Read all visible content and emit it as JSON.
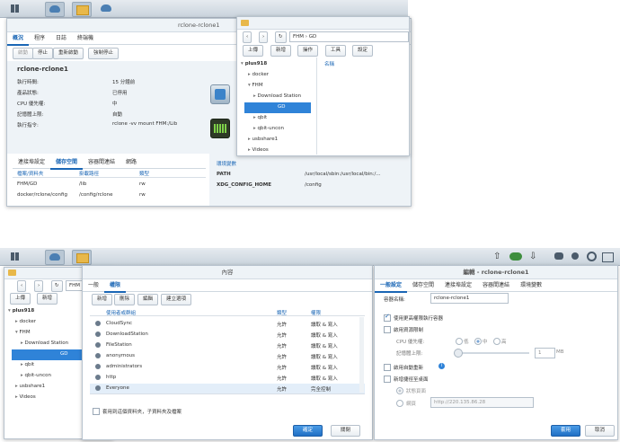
{
  "top_window": {
    "title": "rclone-rclone1",
    "tabs": [
      "概況",
      "程序",
      "日誌",
      "終端機"
    ],
    "buttons": [
      "啟動",
      "停止",
      "重新啟動",
      "強制停止"
    ],
    "container_name": "rclone-rclone1",
    "info": [
      {
        "k": "執行時間:",
        "v": "15 分鐘前"
      },
      {
        "k": "產品狀態:",
        "v": "已停用"
      },
      {
        "k": "CPU 優先權:",
        "v": "中"
      },
      {
        "k": "記憶體上限:",
        "v": "自動"
      },
      {
        "k": "執行指令:",
        "v": "rclone -vv mount FHM:/Lib"
      }
    ],
    "sub_tabs": [
      "連接埠設定",
      "儲存空間",
      "容器間連結",
      "網路"
    ],
    "vol_headers": [
      "檔案/資料夾",
      "掛載路徑",
      "類型"
    ],
    "volumes": [
      {
        "path": "FHM/GD",
        "mount": "/lib",
        "type": "rw"
      },
      {
        "path": "docker/rclone/config",
        "mount": "/config/rclone",
        "type": "rw"
      }
    ],
    "env_title": "環境變數",
    "env": [
      {
        "k": "PATH",
        "v": "/usr/local/sbin:/usr/local/bin:/..."
      },
      {
        "k": "XDG_CONFIG_HOME",
        "v": "/config"
      }
    ]
  },
  "fs_top": {
    "path": "FHM › GD",
    "toolbar": [
      "上傳",
      "新增",
      "操作",
      "工具",
      "設定"
    ],
    "col_name": "名稱",
    "tree": [
      {
        "label": "plus918",
        "bold": true,
        "lvl": 0
      },
      {
        "label": "docker",
        "lvl": 1
      },
      {
        "label": "FHM",
        "lvl": 1
      },
      {
        "label": "Download Station",
        "lvl": 2
      },
      {
        "label": "GD",
        "lvl": 2,
        "sel": true
      },
      {
        "label": "qbit",
        "lvl": 2
      },
      {
        "label": "qbit-uncon",
        "lvl": 2
      },
      {
        "label": "usbshare1",
        "lvl": 1
      },
      {
        "label": "Videos",
        "lvl": 1
      }
    ]
  },
  "fs_bottom": {
    "path": "FHM › GD",
    "toolbar": [
      "上傳",
      "新增"
    ],
    "tree": [
      {
        "label": "plus918",
        "bold": true,
        "lvl": 0
      },
      {
        "label": "docker",
        "lvl": 1
      },
      {
        "label": "FHM",
        "lvl": 1
      },
      {
        "label": "Download Station",
        "lvl": 2
      },
      {
        "label": "GD",
        "lvl": 2,
        "sel": true
      },
      {
        "label": "qbit",
        "lvl": 2
      },
      {
        "label": "qbit-uncon",
        "lvl": 2
      },
      {
        "label": "usbshare1",
        "lvl": 1
      },
      {
        "label": "Videos",
        "lvl": 1
      }
    ]
  },
  "props": {
    "title": "內容",
    "tabs": [
      "一般",
      "權限"
    ],
    "buttons": [
      "新增",
      "刪除",
      "編輯",
      "建立選項"
    ],
    "headers": [
      "使用者或群組",
      "類型",
      "權限"
    ],
    "rows": [
      {
        "name": "CloudSync",
        "type": "允許",
        "perm": "讀取 & 寫入"
      },
      {
        "name": "DownloadStation",
        "type": "允許",
        "perm": "讀取 & 寫入"
      },
      {
        "name": "FileStation",
        "type": "允許",
        "perm": "讀取 & 寫入"
      },
      {
        "name": "anonymous",
        "type": "允許",
        "perm": "讀取 & 寫入"
      },
      {
        "name": "administrators",
        "type": "允許",
        "perm": "讀取 & 寫入"
      },
      {
        "name": "http",
        "type": "允許",
        "perm": "讀取 & 寫入"
      },
      {
        "name": "Everyone",
        "type": "允許",
        "perm": "完全控制"
      }
    ],
    "apply_sub": "套用到這個資料夾，子資料夾及檔案",
    "ok": "確定",
    "close": "關閉"
  },
  "edit": {
    "title": "編輯 - rclone-rclone1",
    "tabs": [
      "一般設定",
      "儲存空間",
      "連接埠設定",
      "容器間連結",
      "環境變數"
    ],
    "name_label": "容器名稱:",
    "name_value": "rclone-rclone1",
    "opt_privileged": "使用更高權限執行容器",
    "opt_limit": "啟用資源限制",
    "cpu_label": "CPU 優先權:",
    "cpu_opts": [
      "低",
      "中",
      "高"
    ],
    "mem_label": "記憶體上限:",
    "mem_value": "1",
    "mem_unit": "MB",
    "opt_autostart": "啟用自動重新",
    "opt_shortcut": "新增捷徑至桌面",
    "shortcut_status": "狀態頁面",
    "shortcut_web": "網頁",
    "web_value": "http://220.135.86.28",
    "apply": "套用",
    "cancel": "取消"
  }
}
